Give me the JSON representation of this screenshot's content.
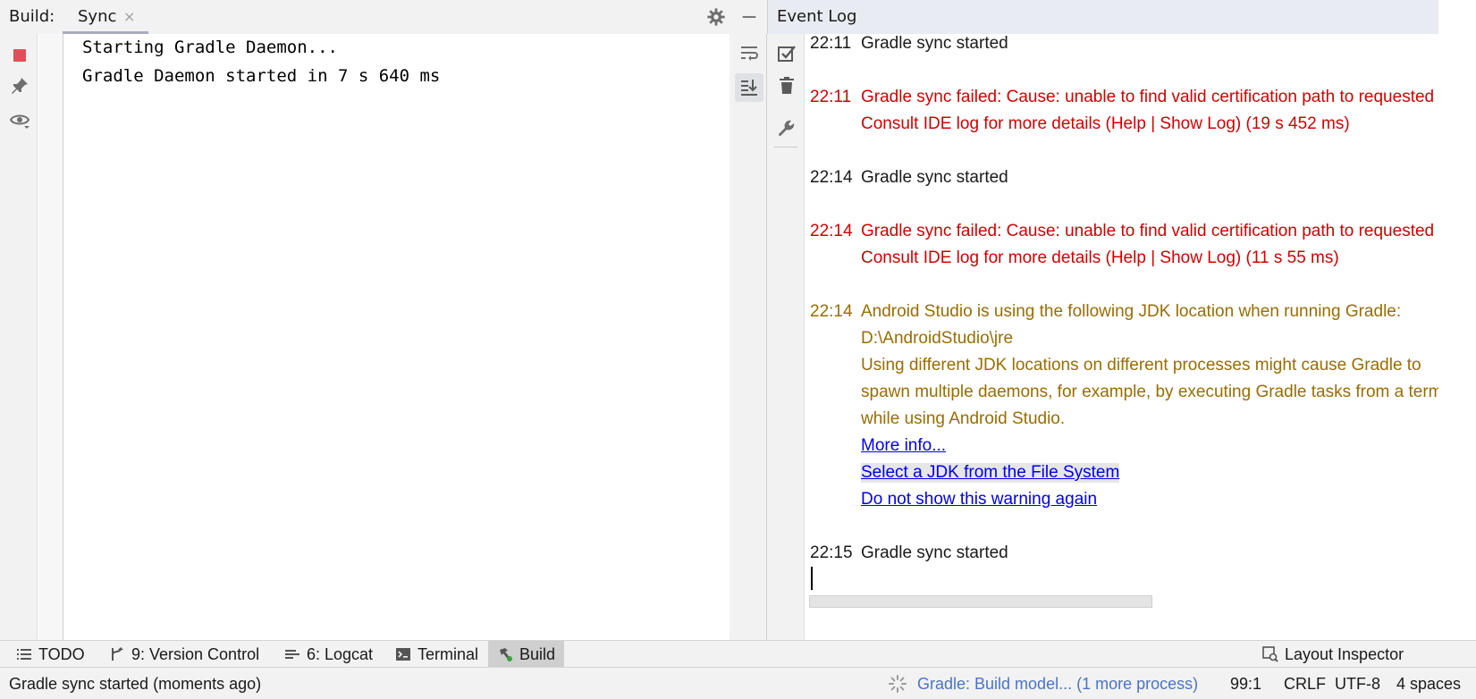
{
  "build_panel": {
    "label": "Build:",
    "tab": {
      "label": "Sync",
      "close": "×"
    },
    "console_lines": [
      "Starting Gradle Daemon...",
      "Gradle Daemon started in 7 s 640 ms"
    ],
    "left_toolbar_icons": [
      "stop-icon",
      "pin-icon",
      "eye-icon"
    ],
    "right_toolbar_icons": [
      "soft-wrap-icon",
      "scroll-to-end-icon"
    ],
    "header_icons": [
      "gear-icon",
      "minimize-icon"
    ]
  },
  "event_log": {
    "title": "Event Log",
    "toolbar_icons": [
      "mark-all-read-icon",
      "trash-icon",
      "wrench-icon"
    ],
    "entries": [
      {
        "time": "22:11",
        "lines": [
          "Gradle sync started"
        ],
        "level": "normal"
      },
      {
        "time": "22:11",
        "lines": [
          "Gradle sync failed: Cause: unable to find valid certification path to requested target",
          "Consult IDE log for more details (Help | Show Log) (19 s 452 ms)"
        ],
        "level": "error"
      },
      {
        "time": "22:14",
        "lines": [
          "Gradle sync started"
        ],
        "level": "normal"
      },
      {
        "time": "22:14",
        "lines": [
          "Gradle sync failed: Cause: unable to find valid certification path to requested target",
          "Consult IDE log for more details (Help | Show Log) (11 s 55 ms)"
        ],
        "level": "error"
      },
      {
        "time": "22:14",
        "lines": [
          "Android Studio is using the following JDK location when running Gradle:",
          "D:\\AndroidStudio\\jre",
          "Using different JDK locations on different processes might cause Gradle to",
          "spawn multiple daemons, for example, by executing Gradle tasks from a terminal",
          "while using Android Studio."
        ],
        "level": "warning",
        "links": [
          "More info...",
          "Select a JDK from the File System",
          "Do not show this warning again"
        ]
      },
      {
        "time": "22:15",
        "lines": [
          "Gradle sync started"
        ],
        "level": "normal"
      }
    ]
  },
  "tool_windows": [
    {
      "label": "TODO",
      "icon": "list-icon",
      "active": false
    },
    {
      "label": "9: Version Control",
      "icon": "branch-icon",
      "active": false
    },
    {
      "label": "6: Logcat",
      "icon": "logcat-icon",
      "active": false
    },
    {
      "label": "Terminal",
      "icon": "terminal-icon",
      "active": false
    },
    {
      "label": "Build",
      "icon": "hammer-icon",
      "active": true
    },
    {
      "label": "Layout Inspector",
      "icon": "layout-inspector-icon",
      "active": false
    }
  ],
  "status_bar": {
    "message": "Gradle sync started (moments ago)",
    "process": "Gradle: Build model... (1 more process)",
    "position": "99:1",
    "line_separator": "CRLF",
    "encoding": "UTF-8",
    "indent": "4 spaces"
  },
  "colors": {
    "error": "#d40000",
    "warning": "#9a6d00",
    "link": "#0000ee",
    "process": "#4a74c9",
    "stop": "#e0505a"
  }
}
